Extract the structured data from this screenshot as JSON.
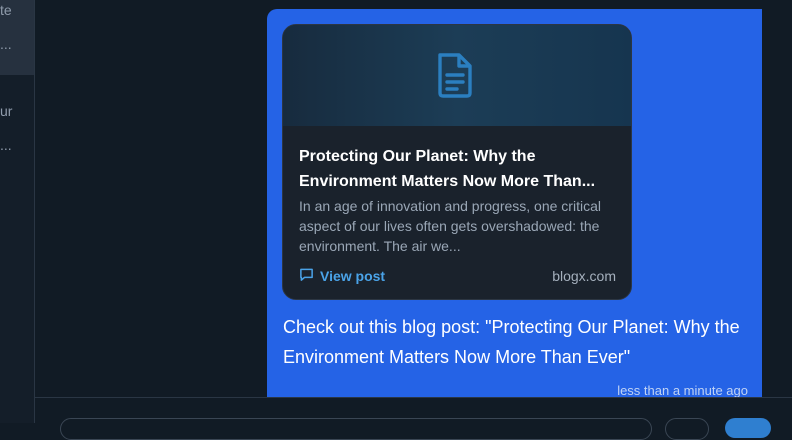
{
  "sidebar": {
    "items": [
      {
        "line1": "te",
        "line2": "..."
      },
      {
        "line1": "ur",
        "line2": "..."
      }
    ]
  },
  "message": {
    "card": {
      "icon": "document-icon",
      "title": "Protecting Our Planet: Why the Environment Matters Now More Than...",
      "excerpt": "In an age of innovation and progress, one critical aspect of our lives often gets overshadowed: the environment. The air we...",
      "link_label": "View post",
      "domain": "blogx.com"
    },
    "text": "Check out this blog post: \"Protecting Our Planet: Why the Environment Matters Now More Than Ever\"",
    "timestamp": "less than a minute ago"
  },
  "colors": {
    "bubble": "#2563e6",
    "card": "#1a222c",
    "link": "#4aa3e8",
    "background": "#111b25"
  }
}
